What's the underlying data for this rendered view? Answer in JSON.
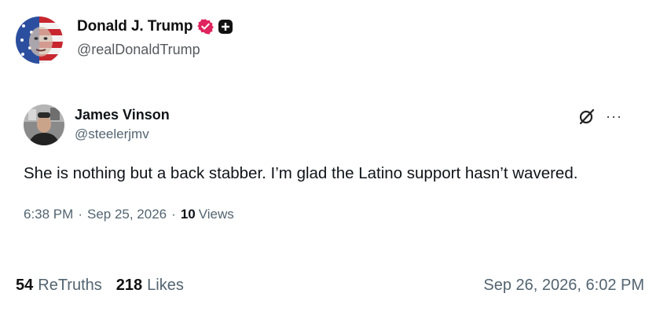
{
  "post": {
    "author_name": "Donald J. Trump",
    "author_handle": "@realDonaldTrump",
    "avatar_icon": "portrait-avatar",
    "verified_icon": "verified-badge-icon",
    "verified_color": "#e0245e",
    "plus_icon": "plus-badge-icon"
  },
  "quoted_post": {
    "author_name": "James Vinson",
    "author_handle": "@steelerjmv",
    "text": "She is nothing but a back stabber. I’m glad the Latino support hasn’t wavered.",
    "time": "6:38 PM",
    "separator": "·",
    "date": "Sep 25, 2026",
    "views_count": "10",
    "views_label": "Views",
    "more_label": "···",
    "grok_icon": "grok-icon"
  },
  "footer": {
    "retruths_count": "54",
    "retruths_label": "ReTruths",
    "likes_count": "218",
    "likes_label": "Likes",
    "date": "Sep 26, 2026, 6:02 PM"
  }
}
